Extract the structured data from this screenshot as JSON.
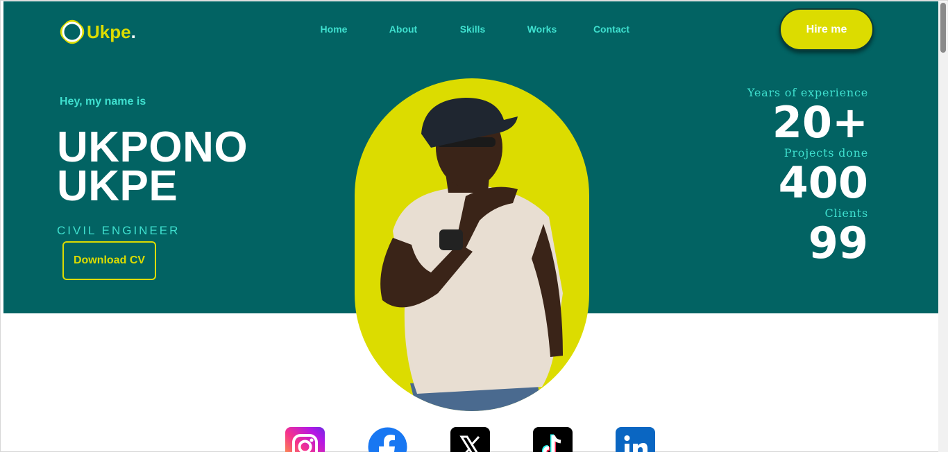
{
  "brand": {
    "name": "Ukpe",
    "dot": ".",
    "accent": "#dcdc00",
    "bg": "#026363",
    "highlight": "#3fe0cf"
  },
  "nav": {
    "items": [
      "Home",
      "About",
      "Skills",
      "Works",
      "Contact"
    ]
  },
  "cta": {
    "hire_label": "Hire me"
  },
  "hero": {
    "greeting": "Hey, my name is",
    "name_line1": "UKPONO",
    "name_line2": "UKPE",
    "role": "CIVIL ENGINEER",
    "download_label": "Download CV"
  },
  "stats": [
    {
      "label": "Years of experience",
      "value": "20+"
    },
    {
      "label": "Projects done",
      "value": "400"
    },
    {
      "label": "Clients",
      "value": "99"
    }
  ],
  "social": [
    "instagram-icon",
    "facebook-icon",
    "x-icon",
    "tiktok-icon",
    "linkedin-icon"
  ]
}
